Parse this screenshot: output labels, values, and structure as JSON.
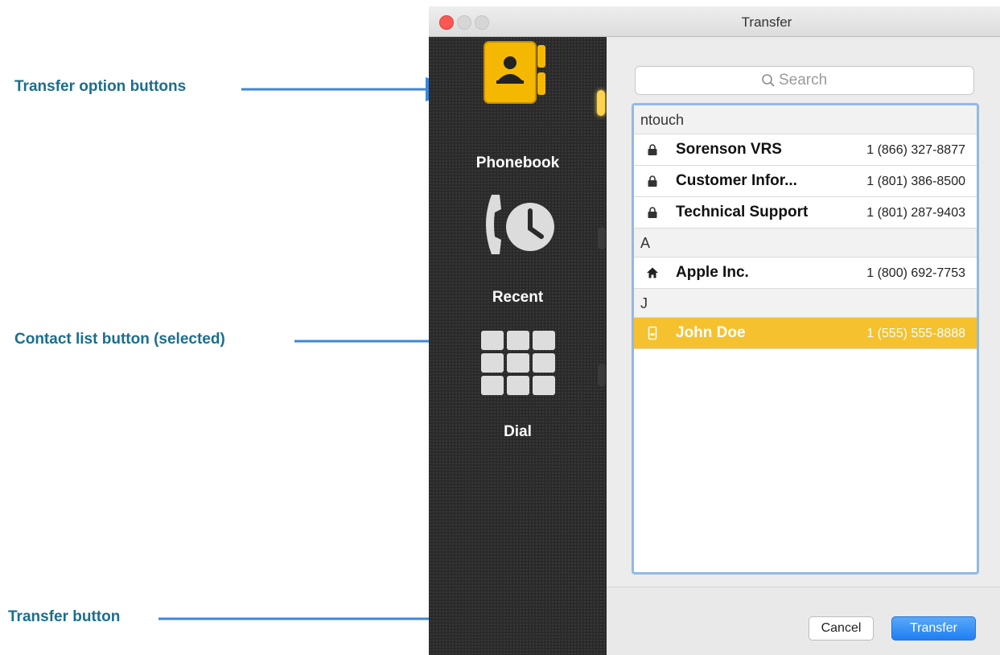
{
  "window": {
    "title": "Transfer"
  },
  "annotations": [
    {
      "text": "Transfer option buttons"
    },
    {
      "text": "Contact list button (selected)"
    },
    {
      "text": "Transfer button"
    }
  ],
  "sidebar": {
    "options": [
      {
        "label": "Phonebook",
        "icon": "phonebook-icon",
        "selected": true
      },
      {
        "label": "Recent",
        "icon": "recent-calls-icon",
        "selected": false
      },
      {
        "label": "Dial",
        "icon": "dial-pad-icon",
        "selected": false
      }
    ]
  },
  "search": {
    "placeholder": "Search"
  },
  "contacts": {
    "sections": [
      {
        "header": "ntouch",
        "rows": [
          {
            "name": "Sorenson VRS",
            "phone": "1 (866) 327-8877",
            "icon": "lock-icon"
          },
          {
            "name": "Customer Infor...",
            "phone": "1 (801) 386-8500",
            "icon": "lock-icon"
          },
          {
            "name": "Technical Support",
            "phone": "1 (801) 287-9403",
            "icon": "lock-icon"
          }
        ]
      },
      {
        "header": "A",
        "rows": [
          {
            "name": "Apple Inc.",
            "phone": "1 (800) 692-7753",
            "icon": "home-icon"
          }
        ]
      },
      {
        "header": "J",
        "rows": [
          {
            "name": "John Doe",
            "phone": "1 (555) 555-8888",
            "icon": "mobile-phone-icon",
            "selected": true
          }
        ]
      }
    ]
  },
  "buttons": {
    "cancel": "Cancel",
    "transfer": "Transfer"
  },
  "colors": {
    "accent": "#1f7ff2",
    "selection": "#f5c12e",
    "annotation": "#1a6e8e",
    "arrow": "#3b87d8"
  }
}
